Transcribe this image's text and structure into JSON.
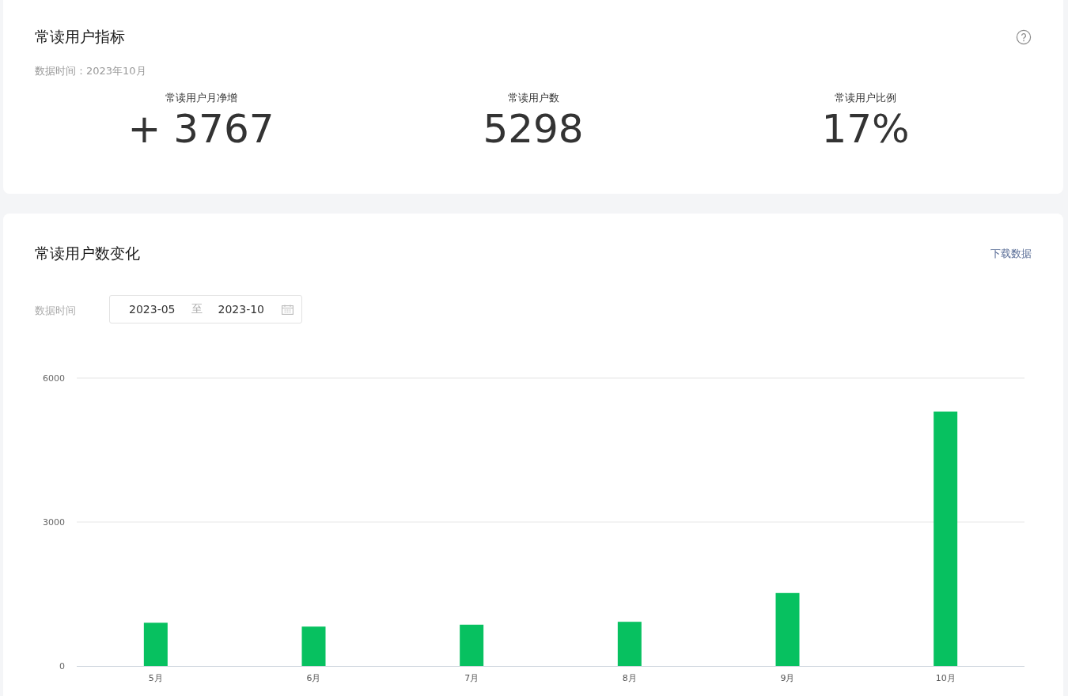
{
  "metrics_card": {
    "title": "常读用户指标",
    "data_time": "数据时间：2023年10月",
    "metrics": [
      {
        "label": "常读用户月净增",
        "value": "+ 3767"
      },
      {
        "label": "常读用户数",
        "value": "5298"
      },
      {
        "label": "常读用户比例",
        "value": "17%"
      }
    ]
  },
  "trend_card": {
    "title": "常读用户数变化",
    "download_link": "下载数据",
    "date_label": "数据时间",
    "date_start": "2023-05",
    "date_separator": "至",
    "date_end": "2023-10",
    "chart_data": {
      "type": "bar",
      "categories": [
        "5月",
        "6月",
        "7月",
        "8月",
        "9月",
        "10月"
      ],
      "series": [
        {
          "color": "#07c160",
          "values": [
            900,
            820,
            860,
            920,
            1520,
            5300
          ]
        }
      ],
      "ylim": [
        0,
        6000
      ],
      "yticks": [
        0,
        3000,
        6000
      ]
    }
  }
}
